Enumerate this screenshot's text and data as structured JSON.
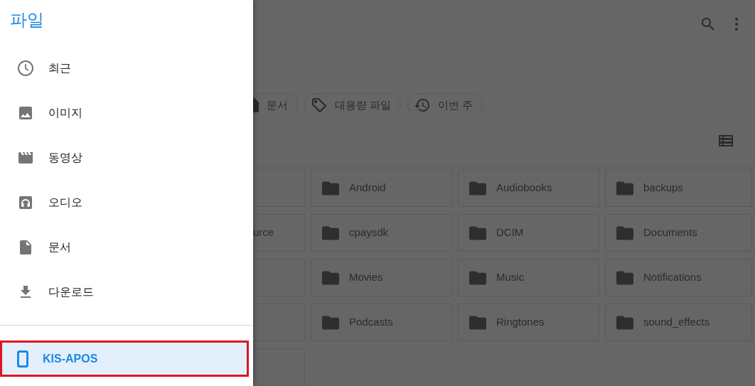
{
  "drawer": {
    "title": "파일",
    "items": [
      {
        "label": "최근",
        "selected": false
      },
      {
        "label": "이미지",
        "selected": false
      },
      {
        "label": "동영상",
        "selected": false
      },
      {
        "label": "오디오",
        "selected": false
      },
      {
        "label": "문서",
        "selected": false
      },
      {
        "label": "다운로드",
        "selected": false
      }
    ],
    "devices": [
      {
        "label": "KIS-APOS",
        "selected": true,
        "highlighted": true
      }
    ]
  },
  "main": {
    "chips": [
      {
        "label": "문서",
        "kind": "cut"
      },
      {
        "label": "대용량 파일",
        "kind": "chip"
      },
      {
        "label": "이번 주",
        "kind": "chip"
      }
    ],
    "folders": [
      {
        "kind": "cut"
      },
      {
        "kind": "folder",
        "name": "Android"
      },
      {
        "kind": "folder",
        "name": "Audiobooks"
      },
      {
        "kind": "folder",
        "name": "backups"
      },
      {
        "kind": "cut",
        "name": "urce"
      },
      {
        "kind": "folder",
        "name": "cpaysdk"
      },
      {
        "kind": "folder",
        "name": "DCIM"
      },
      {
        "kind": "folder",
        "name": "Documents"
      },
      {
        "kind": "cut"
      },
      {
        "kind": "folder",
        "name": "Movies"
      },
      {
        "kind": "folder",
        "name": "Music"
      },
      {
        "kind": "folder",
        "name": "Notifications"
      },
      {
        "kind": "cut"
      },
      {
        "kind": "folder",
        "name": "Podcasts"
      },
      {
        "kind": "folder",
        "name": "Ringtones"
      },
      {
        "kind": "folder",
        "name": "sound_effects"
      },
      {
        "kind": "cut"
      }
    ]
  }
}
